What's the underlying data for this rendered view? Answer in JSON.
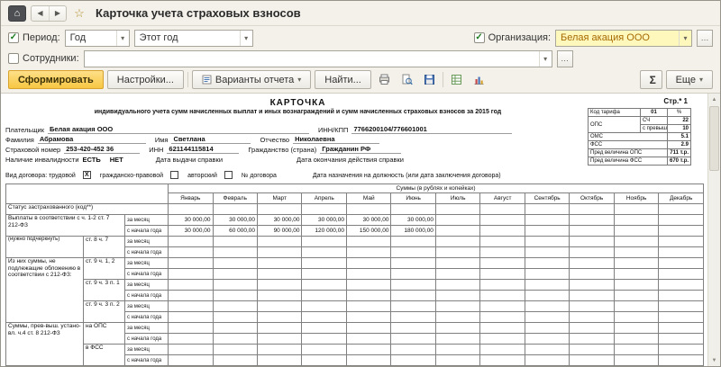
{
  "window": {
    "title": "Карточка учета страховых взносов"
  },
  "icons": {
    "home": "⌂",
    "back": "◀",
    "forward": "▶",
    "star": "☆",
    "check": "✓",
    "dropdown": "▾",
    "ellipsis": "…",
    "scroll_up": "▲",
    "scroll_down": "▼"
  },
  "filters": {
    "period_label": "Период:",
    "period_unit": "Год",
    "period_range": "Этот год",
    "org_label": "Организация:",
    "org_value": "Белая акация ООО",
    "employees_label": "Сотрудники:",
    "employees_value": ""
  },
  "toolbar": {
    "generate": "Сформировать",
    "settings": "Настройки...",
    "variants": "Варианты отчета",
    "find": "Найти...",
    "sum": "Σ",
    "more": "Еще"
  },
  "report": {
    "page": "Стр.* 1",
    "title": "КАРТОЧКА",
    "subtitle": "индивидуального учета сумм начисленных выплат и иных вознаграждений и сумм начисленных страховых взносов за 2015 год",
    "tariff": {
      "code_label": "Код тарифа",
      "code_value": "01",
      "percent": "%",
      "ops_label": "ОПС",
      "sch_label": "СЧ",
      "sch_value": "22",
      "prev_label": "с превыш.",
      "prev_value": "10",
      "oms_label": "ОМС",
      "oms_value": "5.1",
      "fss_label": "ФСС",
      "fss_value": "2.9",
      "pred_ops_label": "Пред величина ОПС",
      "pred_ops_value": "711 т.р.",
      "pred_fss_label": "Пред величина ФСС",
      "pred_fss_value": "670 т.р."
    },
    "payer": {
      "payer_label": "Плательщик",
      "payer_name": "Белая акация ООО",
      "innkpp_label": "ИНН/КПП",
      "innkpp_value": "7766200104/776601001",
      "lastname_label": "Фамилия",
      "lastname": "Абрамова",
      "firstname_label": "Имя",
      "firstname": "Светлана",
      "middlename_label": "Отчество",
      "middlename": "Николаевна",
      "snils_label": "Страховой номер",
      "snils": "253-420-452 36",
      "inn_label": "ИНН",
      "inn": "621144115814",
      "citizenship_label": "Гражданство (страна)",
      "citizenship": "Гражданин РФ",
      "disability_label": "Наличие инвалидности",
      "disability_yes": "ЕСТЬ",
      "disability_no": "НЕТ",
      "cert_issue_label": "Дата выдачи справки",
      "cert_expiry_label": "Дата окончания действия справки",
      "contract_label": "Вид договора: трудовой",
      "contract_mark": "X",
      "contract_civil": "гражданско-правовой",
      "contract_author": "авторский",
      "contract_no_label": "№ договора",
      "appointment_label": "Дата назначения на должность (или дата заключения договора)"
    },
    "table": {
      "sums_header": "Суммы (в рублях и копейках)",
      "months": [
        "Январь",
        "Февраль",
        "Март",
        "Апрель",
        "Май",
        "Июнь",
        "Июль",
        "Август",
        "Сентябрь",
        "Октябрь",
        "Ноябрь",
        "Декабрь"
      ],
      "status_label": "Статус застрахованного (код**)",
      "underline_note": "(нужно подчеркнуть)",
      "per_month": "за месяц",
      "ytd": "с начала года",
      "payments_label": "Выплаты в соответствии с ч. 1-2 ст. 7 212-ФЗ",
      "payments_month": [
        "30 000,00",
        "30 000,00",
        "30 000,00",
        "30 000,00",
        "30 000,00",
        "30 000,00",
        "",
        "",
        "",
        "",
        "",
        ""
      ],
      "payments_ytd": [
        "30 000,00",
        "60 000,00",
        "90 000,00",
        "120 000,00",
        "150 000,00",
        "180 000,00",
        "",
        "",
        "",
        "",
        "",
        ""
      ],
      "excluded_label": "Из них суммы, не подлежащие обложению в соответствии с 212-ФЗ:",
      "excl_1": "ст. 8 ч. 7",
      "excl_2": "ст. 9 ч. 1, 2",
      "excl_3": "ст. 9 ч. 3 п. 1",
      "excl_4": "ст. 9 ч. 3 п. 2",
      "over_label": "Суммы, прев-выш. устано-вл. ч.4 ст. 8 212-ФЗ",
      "over_1": "на ОПС",
      "over_2": "в ФСС"
    }
  }
}
